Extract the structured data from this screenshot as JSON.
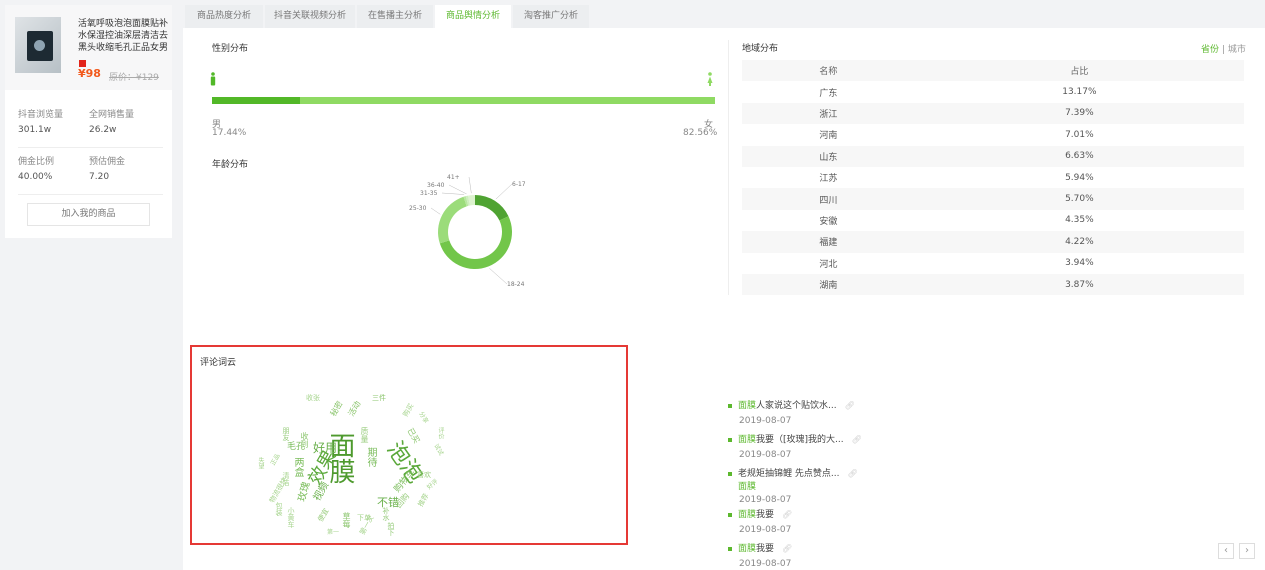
{
  "product": {
    "title": "活氧呼吸泡泡面膜贴补水保湿控油深层清洁去黑头收缩毛孔正品女男",
    "price": "¥98",
    "original_price": "原价：¥129",
    "stats": [
      {
        "label": "抖音浏览量",
        "value": "301.1w"
      },
      {
        "label": "全网销售量",
        "value": "26.2w"
      },
      {
        "label": "佣金比例",
        "value": "40.00%"
      },
      {
        "label": "预估佣金",
        "value": "7.20"
      }
    ],
    "add_button": "加入我的商品"
  },
  "tabs": [
    "商品热度分析",
    "抖音关联视频分析",
    "在售播主分析",
    "商品舆情分析",
    "淘客推广分析"
  ],
  "active_tab": 3,
  "gender": {
    "title": "性别分布",
    "male_label": "男",
    "male_pct": "17.44%",
    "female_label": "女",
    "female_pct": "82.56%",
    "male_fraction": 0.1744,
    "colors": {
      "male": "#52b828",
      "female": "#8fda63"
    }
  },
  "age": {
    "title": "年龄分布",
    "segments": [
      {
        "label": "6-17",
        "value": 18,
        "color": "#4fa332"
      },
      {
        "label": "18-24",
        "value": 52,
        "color": "#72c64a"
      },
      {
        "label": "25-30",
        "value": 25,
        "color": "#9bdc7a"
      },
      {
        "label": "31-35",
        "value": 1,
        "color": "#b7e79f"
      },
      {
        "label": "36-40",
        "value": 1,
        "color": "#cdeebd"
      },
      {
        "label": "41+",
        "value": 3,
        "color": "#ddf3cf"
      }
    ]
  },
  "region": {
    "title": "地域分布",
    "toggle_province": "省份",
    "toggle_sep": "|",
    "toggle_city": "城市",
    "headers": [
      "名称",
      "占比"
    ],
    "rows": [
      [
        "广东",
        "13.17%"
      ],
      [
        "浙江",
        "7.39%"
      ],
      [
        "河南",
        "7.01%"
      ],
      [
        "山东",
        "6.63%"
      ],
      [
        "江苏",
        "5.94%"
      ],
      [
        "四川",
        "5.70%"
      ],
      [
        "安徽",
        "4.35%"
      ],
      [
        "福建",
        "4.22%"
      ],
      [
        "河北",
        "3.94%"
      ],
      [
        "湖南",
        "3.87%"
      ]
    ]
  },
  "wordcloud": {
    "title": "评论词云",
    "words": [
      "面膜",
      "泡泡",
      "效果",
      "好用",
      "不错",
      "视频",
      "两盒",
      "毛孔",
      "玫瑰",
      "期待",
      "购物车",
      "已买",
      "草莓",
      "秘密",
      "活动",
      "三件",
      "收到",
      "朋友",
      "质量",
      "回购",
      "喜欢",
      "补水",
      "拍下",
      "便宜",
      "第一",
      "包装",
      "物流很快",
      "清洁",
      "收张",
      "失望",
      "购买",
      "小黄车",
      "正品",
      "试试",
      "分享",
      "好评",
      "推荐",
      "下单",
      "第一次",
      "评价"
    ]
  },
  "comments": [
    {
      "kw": "面膜",
      "text": "人家说这个贴饮水...",
      "date": "2019-08-07"
    },
    {
      "kw": "面膜",
      "text": "我要（[玫瑰]我的大...",
      "date": "2019-08-07"
    },
    {
      "kw": "面膜",
      "text": "老规矩抽锦鲤 先点赞点...",
      "date": "2019-08-07",
      "kw_after": true
    },
    {
      "kw": "面膜",
      "text": "我要",
      "date": "2019-08-07"
    },
    {
      "kw": "面膜",
      "text": "我要",
      "date": "2019-08-07"
    }
  ],
  "pagination": {
    "prev": "‹",
    "next": "›"
  }
}
